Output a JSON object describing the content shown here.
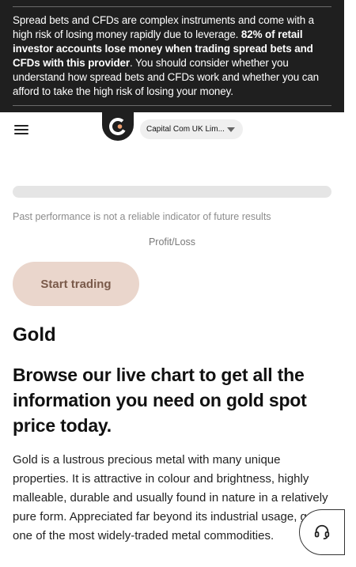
{
  "risk_warning": {
    "part1": "Spread bets and CFDs are complex instruments and come with a high risk of losing money rapidly due to leverage. ",
    "bold": "82% of retail investor accounts lose money when trading spread bets and CFDs with this provider",
    "part2": ". You should consider whether you understand how spread bets and CFDs work and whether you can afford to take the high risk of losing your money."
  },
  "header": {
    "menu_icon": "hamburger-menu-icon",
    "logo_icon": "capital-com-logo",
    "entity_select": "Capital Com UK Lim...",
    "caret_icon": "caret-down-icon"
  },
  "main": {
    "past_performance": "Past performance is not a reliable indicator of future results",
    "profit_loss_label": "Profit/Loss",
    "start_trading_label": "Start trading",
    "asset_title": "Gold",
    "headline": "Browse our live chart to get all the information you need on gold spot price today.",
    "description": "Gold is a lustrous precious metal with many unique properties. It is attractive in colour and brightness, highly malleable, durable and usually found in nature in a relatively pure form. Appreciated far beyond its industrial usage, gold is one of the most widely-traded metal commodities."
  },
  "support": {
    "icon": "headset-icon"
  },
  "colors": {
    "banner_bg": "#1f1f1f",
    "button_bg": "#ead6cc",
    "button_text": "#7a5a4a",
    "logo_accent": "#f0a070"
  }
}
